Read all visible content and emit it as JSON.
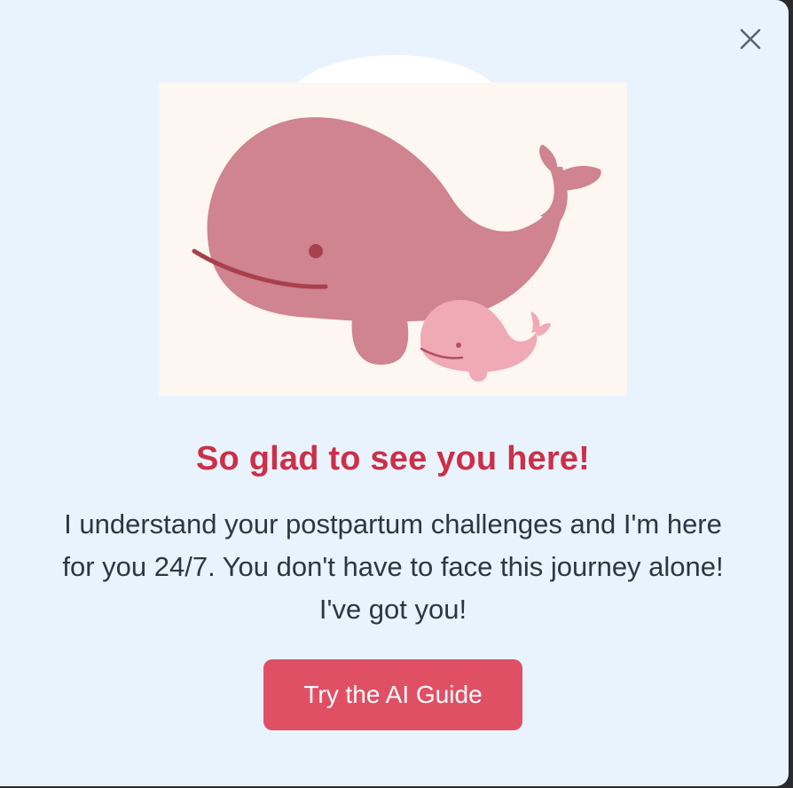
{
  "modal": {
    "heading": "So glad to see you here!",
    "body": "I understand your postpartum challenges and I'm here for you 24/7. You don't have to face this journey alone! I've got you!",
    "cta_label": "Try the AI Guide",
    "close_icon": "close-icon",
    "illustration": "mother-and-baby-whale-illustration"
  },
  "colors": {
    "modal_background": "#e9f3fd",
    "heading": "#cc3048",
    "body_text": "#2c3744",
    "button": "#e05065",
    "mother_whale": "#cf848f",
    "baby_whale": "#f0aab5",
    "illustration_background": "#fdf6f1"
  }
}
